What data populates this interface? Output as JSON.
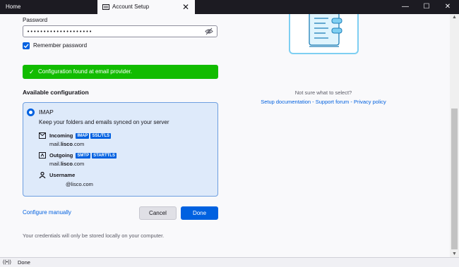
{
  "tabs": {
    "home_label": "Home",
    "active_label": "Account Setup",
    "active_icon": "mail-setup-icon",
    "close_glyph": "✕"
  },
  "window_controls": {
    "minimize": "—",
    "maximize": "☐",
    "close": "✕"
  },
  "form": {
    "password_label": "Password",
    "password_value": "••••••••••••••••••••",
    "remember_label": "Remember password",
    "remember_checked": true
  },
  "success": {
    "check_glyph": "✓",
    "message": "Configuration found at email provider."
  },
  "available": {
    "heading": "Available configuration",
    "protocol": "IMAP",
    "description": "Keep your folders and emails synced on your server",
    "incoming": {
      "label": "Incoming",
      "badge1": "IMAP",
      "badge2": "SSL/TLS",
      "host_prefix": "mail.",
      "host_bold": "lisco",
      "host_suffix": ".com"
    },
    "outgoing": {
      "label": "Outgoing",
      "badge1": "SMTP",
      "badge2": "STARTTLS",
      "host_prefix": "mail.",
      "host_bold": "lisco",
      "host_suffix": ".com"
    },
    "username": {
      "label": "Username",
      "value": "@lisco.com"
    }
  },
  "actions": {
    "configure_manually": "Configure manually",
    "cancel": "Cancel",
    "done": "Done"
  },
  "credentials_note": "Your credentials will only be stored locally on your computer.",
  "help": {
    "prompt": "Not sure what to select?",
    "link_setup": "Setup documentation",
    "separator": " - ",
    "link_forum": "Support forum",
    "link_privacy": "Privacy policy"
  },
  "status": {
    "icon_glyph": "((•))",
    "text": "Done"
  },
  "scroll": {
    "up": "▲",
    "down": "▼"
  },
  "colors": {
    "accent": "#0061e0",
    "success": "#12bc00",
    "titlebar": "#1c1b22",
    "card_bg": "#deeafa"
  }
}
